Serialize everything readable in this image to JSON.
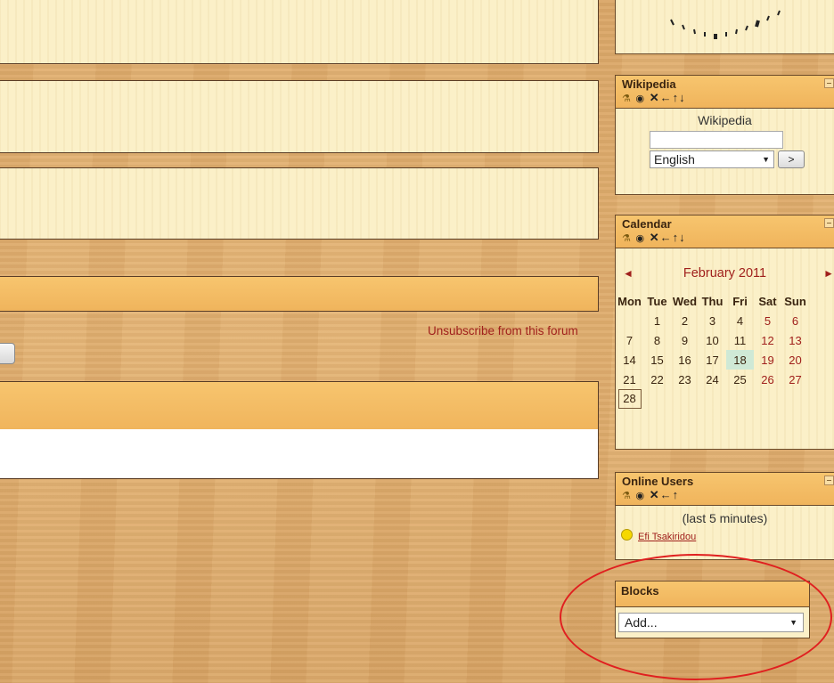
{
  "forum": {
    "unsubscribe_link": "Unsubscribe from this forum"
  },
  "wikipedia": {
    "title": "Wikipedia",
    "search_label": "Wikipedia",
    "search_value": "",
    "language": "English",
    "go_label": ">"
  },
  "calendar": {
    "title": "Calendar",
    "month": "February 2011",
    "prev": "◄",
    "next": "►",
    "days": [
      "Mon",
      "Tue",
      "Wed",
      "Thu",
      "Fri",
      "Sat",
      "Sun"
    ],
    "weeks": [
      [
        "",
        "1",
        "2",
        "3",
        "4",
        "5",
        "6"
      ],
      [
        "7",
        "8",
        "9",
        "10",
        "11",
        "12",
        "13"
      ],
      [
        "14",
        "15",
        "16",
        "17",
        "18",
        "19",
        "20"
      ],
      [
        "21",
        "22",
        "23",
        "24",
        "25",
        "26",
        "27"
      ],
      [
        "28",
        "",
        "",
        "",
        "",
        "",
        ""
      ]
    ],
    "today": "18"
  },
  "online_users": {
    "title": "Online Users",
    "note": "(last 5 minutes)",
    "user": "Efi Tsakiridou"
  },
  "blocks": {
    "title": "Blocks",
    "select_value": "Add..."
  },
  "icons": {
    "edit": "roles-icon",
    "hide": "eye-icon",
    "delete": "delete-icon",
    "move_left": "arrow-left-icon",
    "move_up": "arrow-up-icon",
    "move_down": "arrow-down-icon"
  },
  "colors": {
    "link_red": "#a0201c",
    "annotation": "#e02020"
  }
}
